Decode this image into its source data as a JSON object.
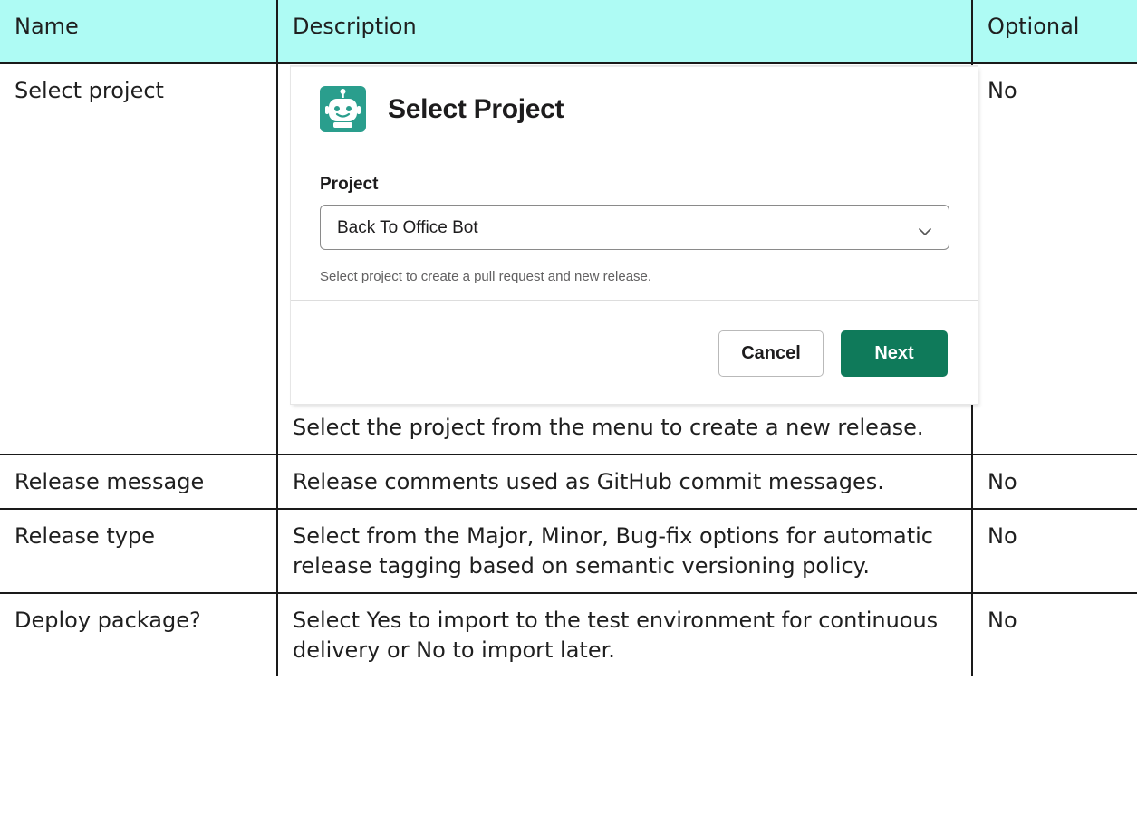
{
  "table": {
    "headers": {
      "name": "Name",
      "description": "Description",
      "optional": "Optional"
    },
    "rows": [
      {
        "name": "Select project",
        "description": "Select the project from the menu to create a new release.",
        "optional": "No"
      },
      {
        "name": "Release message",
        "description": "Release comments used as GitHub commit messages.",
        "optional": "No"
      },
      {
        "name": "Release type",
        "description": "Select from the Major, Minor, Bug-fix options for automatic release tagging based on semantic versioning policy.",
        "optional": "No"
      },
      {
        "name": "Deploy package?",
        "description": "Select Yes to import to the test environment for continuous delivery or No to import later.",
        "optional": "No"
      }
    ]
  },
  "dialog": {
    "title": "Select Project",
    "icon": "robot-icon",
    "icon_color": "#2a9e8d",
    "field_label": "Project",
    "select_value": "Back To Office Bot",
    "hint": "Select project to create a pull request and new release.",
    "cancel_label": "Cancel",
    "next_label": "Next",
    "next_color": "#0f7a5a"
  },
  "colors": {
    "header_bg": "#aefbf4",
    "border": "#1a1a1a"
  }
}
